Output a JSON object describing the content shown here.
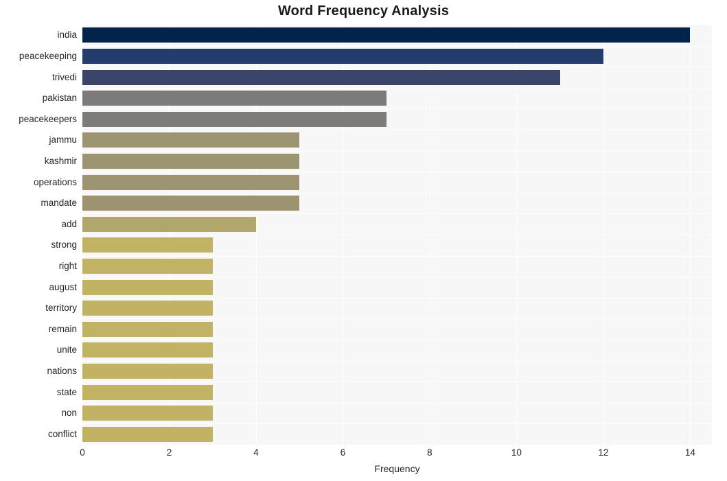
{
  "chart_data": {
    "type": "bar",
    "orientation": "horizontal",
    "title": "Word Frequency Analysis",
    "xlabel": "Frequency",
    "ylabel": "",
    "xlim": [
      0,
      14.5
    ],
    "xticks": [
      0,
      2,
      4,
      6,
      8,
      10,
      12,
      14
    ],
    "grid": true,
    "grid_axis": "both",
    "legend": "none",
    "categories": [
      "india",
      "peacekeeping",
      "trivedi",
      "pakistan",
      "peacekeepers",
      "jammu",
      "kashmir",
      "operations",
      "mandate",
      "add",
      "strong",
      "right",
      "august",
      "territory",
      "remain",
      "unite",
      "nations",
      "state",
      "non",
      "conflict"
    ],
    "values": [
      14,
      12,
      11,
      7,
      7,
      5,
      5,
      5,
      5,
      4,
      3,
      3,
      3,
      3,
      3,
      3,
      3,
      3,
      3,
      3
    ],
    "colors": [
      "#04234b",
      "#243c6c",
      "#3b4469",
      "#7c7b79",
      "#7d7c79",
      "#9d9472",
      "#9d9472",
      "#9d9472",
      "#9d9371",
      "#b1a66c",
      "#c2b264",
      "#c2b264",
      "#c2b264",
      "#c2b264",
      "#c2b264",
      "#c2b264",
      "#c2b264",
      "#c2b264",
      "#c2b264",
      "#c2b264"
    ],
    "plot_background": "#f7f7f7",
    "figure_background": "#ffffff",
    "gridline_color": "#ffffff",
    "text_color": "#262626"
  }
}
